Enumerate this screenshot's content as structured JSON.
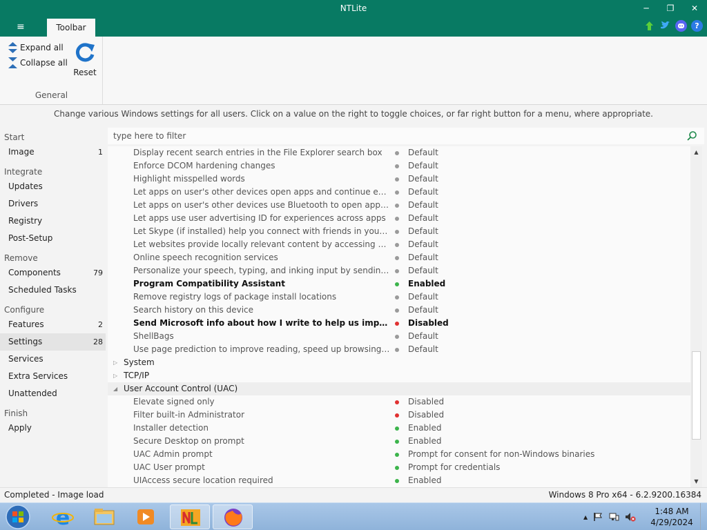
{
  "window": {
    "title": "NTLite",
    "minimize_glyph": "─",
    "maximize_glyph": "❐",
    "close_glyph": "✕"
  },
  "ribbon": {
    "menu_glyph": "≡",
    "tab_label": "Toolbar",
    "expand_all": "Expand all",
    "collapse_all": "Collapse all",
    "reset": "Reset",
    "group_label": "General",
    "top_icons": [
      "upload-arrow-icon",
      "twitter-icon",
      "discord-icon",
      "help-icon"
    ],
    "help_glyph": "?"
  },
  "hint": "Change various Windows settings for all users. Click on a value on the right to toggle choices, or far right button for a menu, where appropriate.",
  "filter": {
    "placeholder": "type here to filter"
  },
  "nav": {
    "sections": [
      "Start",
      "Integrate",
      "Remove",
      "Configure",
      "Finish"
    ],
    "items": [
      {
        "label": "Image",
        "count": "1"
      },
      {
        "label": "Updates",
        "count": ""
      },
      {
        "label": "Drivers",
        "count": ""
      },
      {
        "label": "Registry",
        "count": ""
      },
      {
        "label": "Post-Setup",
        "count": ""
      },
      {
        "label": "Components",
        "count": "79"
      },
      {
        "label": "Scheduled Tasks",
        "count": ""
      },
      {
        "label": "Features",
        "count": "2"
      },
      {
        "label": "Settings",
        "count": "28"
      },
      {
        "label": "Services",
        "count": ""
      },
      {
        "label": "Extra Services",
        "count": ""
      },
      {
        "label": "Unattended",
        "count": ""
      },
      {
        "label": "Apply",
        "count": ""
      }
    ]
  },
  "rows": [
    {
      "name": "Display recent search entries in the File Explorer search box",
      "value": "Default",
      "status": "grey"
    },
    {
      "name": "Enforce DCOM hardening changes",
      "value": "Default",
      "status": "grey"
    },
    {
      "name": "Highlight misspelled words",
      "value": "Default",
      "status": "grey"
    },
    {
      "name": "Let apps on user's other devices open apps and continue experience...",
      "value": "Default",
      "status": "grey"
    },
    {
      "name": "Let apps on user's other devices use Bluetooth to open apps and con...",
      "value": "Default",
      "status": "grey"
    },
    {
      "name": "Let apps use user advertising ID for experiences across apps",
      "value": "Default",
      "status": "grey"
    },
    {
      "name": "Let Skype (if installed) help you connect with friends in your address ...",
      "value": "Default",
      "status": "grey"
    },
    {
      "name": "Let websites provide locally relevant content by accessing user langu...",
      "value": "Default",
      "status": "grey"
    },
    {
      "name": "Online speech recognition services",
      "value": "Default",
      "status": "grey"
    },
    {
      "name": "Personalize your speech, typing, and inking input by sending your in...",
      "value": "Default",
      "status": "grey"
    },
    {
      "name": "Program Compatibility Assistant",
      "value": "Enabled",
      "status": "green",
      "bold": true
    },
    {
      "name": "Remove registry logs of package install locations",
      "value": "Default",
      "status": "grey"
    },
    {
      "name": "Search history on this device",
      "value": "Default",
      "status": "grey"
    },
    {
      "name": "Send Microsoft info about how I write to help us improve typing and...",
      "value": "Disabled",
      "status": "red",
      "bold": true
    },
    {
      "name": "ShellBags",
      "value": "Default",
      "status": "grey"
    },
    {
      "name": "Use page prediction to improve reading, speed up browsing. Your br...",
      "value": "Default",
      "status": "grey"
    }
  ],
  "groups": [
    {
      "name": "System",
      "expanded": false,
      "glyph": "▷"
    },
    {
      "name": "TCP/IP",
      "expanded": false,
      "glyph": "▷"
    },
    {
      "name": "User Account Control (UAC)",
      "expanded": true,
      "glyph": "◢"
    }
  ],
  "uac_rows": [
    {
      "name": "Elevate signed only",
      "value": "Disabled",
      "status": "red"
    },
    {
      "name": "Filter built-in Administrator",
      "value": "Disabled",
      "status": "red"
    },
    {
      "name": "Installer detection",
      "value": "Enabled",
      "status": "green"
    },
    {
      "name": "Secure Desktop on prompt",
      "value": "Enabled",
      "status": "green"
    },
    {
      "name": "UAC Admin prompt",
      "value": "Prompt for consent for non-Windows binaries",
      "status": "green"
    },
    {
      "name": "UAC User prompt",
      "value": "Prompt for credentials",
      "status": "green"
    },
    {
      "name": "UIAccess secure location required",
      "value": "Enabled",
      "status": "green"
    }
  ],
  "scrollbar": {
    "up_glyph": "▲",
    "down_glyph": "▼"
  },
  "status": {
    "left": "Completed - Image load",
    "right": "Windows 8 Pro x64 - 6.2.9200.16384"
  },
  "taskbar": {
    "apps": [
      "internet-explorer-icon",
      "file-explorer-icon",
      "media-player-icon",
      "ntlite-icon",
      "firefox-icon"
    ],
    "tray_glyph": "▲",
    "time": "1:48 AM",
    "date": "4/29/2024"
  },
  "colors": {
    "accent": "#087a63",
    "green": "#3cb44b",
    "red": "#e03131",
    "grey": "#9a9a9a"
  }
}
